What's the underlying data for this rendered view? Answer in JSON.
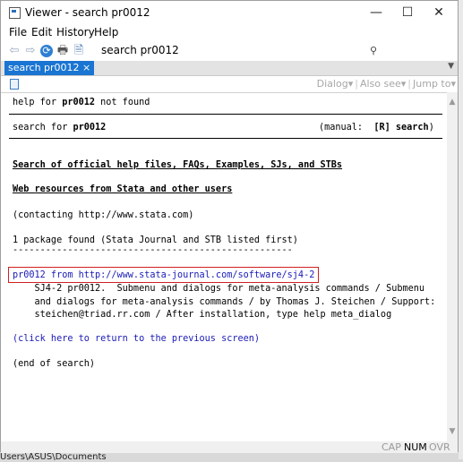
{
  "window": {
    "title": "Viewer - search pr0012",
    "minimize": "—",
    "maximize": "☐",
    "close": "✕"
  },
  "menu": {
    "file": "File",
    "edit": "Edit",
    "history": "History",
    "help": "Help"
  },
  "toolbar": {
    "search_value": "search pr0012",
    "find_placeholder": ""
  },
  "tab": {
    "label": "search pr0012 ×"
  },
  "subbar": {
    "dialog": "Dialog",
    "also_see": "Also see",
    "jump_to": "Jump to"
  },
  "content": {
    "line1_pre": "help for ",
    "line1_bold": "pr0012",
    "line1_post": " not found",
    "line2_pre": "search for ",
    "line2_bold": "pr0012",
    "line2_manual": "(manual:  ",
    "line2_manual_bold": "[R] search",
    "line2_close": ")",
    "heading1": "Search of official help files, FAQs, Examples, SJs, and STBs",
    "heading2": "Web resources from Stata and other users",
    "contacting": "(contacting http://www.stata.com)",
    "found": "1 package found (Stata Journal and STB listed first)",
    "dashes": "---------------------------------------------------",
    "pkg_link": "pr0012 from http://www.stata-journal.com/software/sj4-2",
    "desc1": "    SJ4-2 pr0012.  Submenu and dialogs for meta-analysis commands / Submenu",
    "desc2": "    and dialogs for meta-analysis commands / by Thomas J. Steichen / Support:",
    "desc3": "    steichen@triad.rr.com / After installation, type help meta_dialog",
    "return_link": "(click here to return to the previous screen)",
    "end": "(end of search)"
  },
  "status": {
    "cap": "CAP",
    "num": "NUM",
    "ovr": "OVR"
  },
  "bottom_path": "Users\\ASUS\\Documents"
}
